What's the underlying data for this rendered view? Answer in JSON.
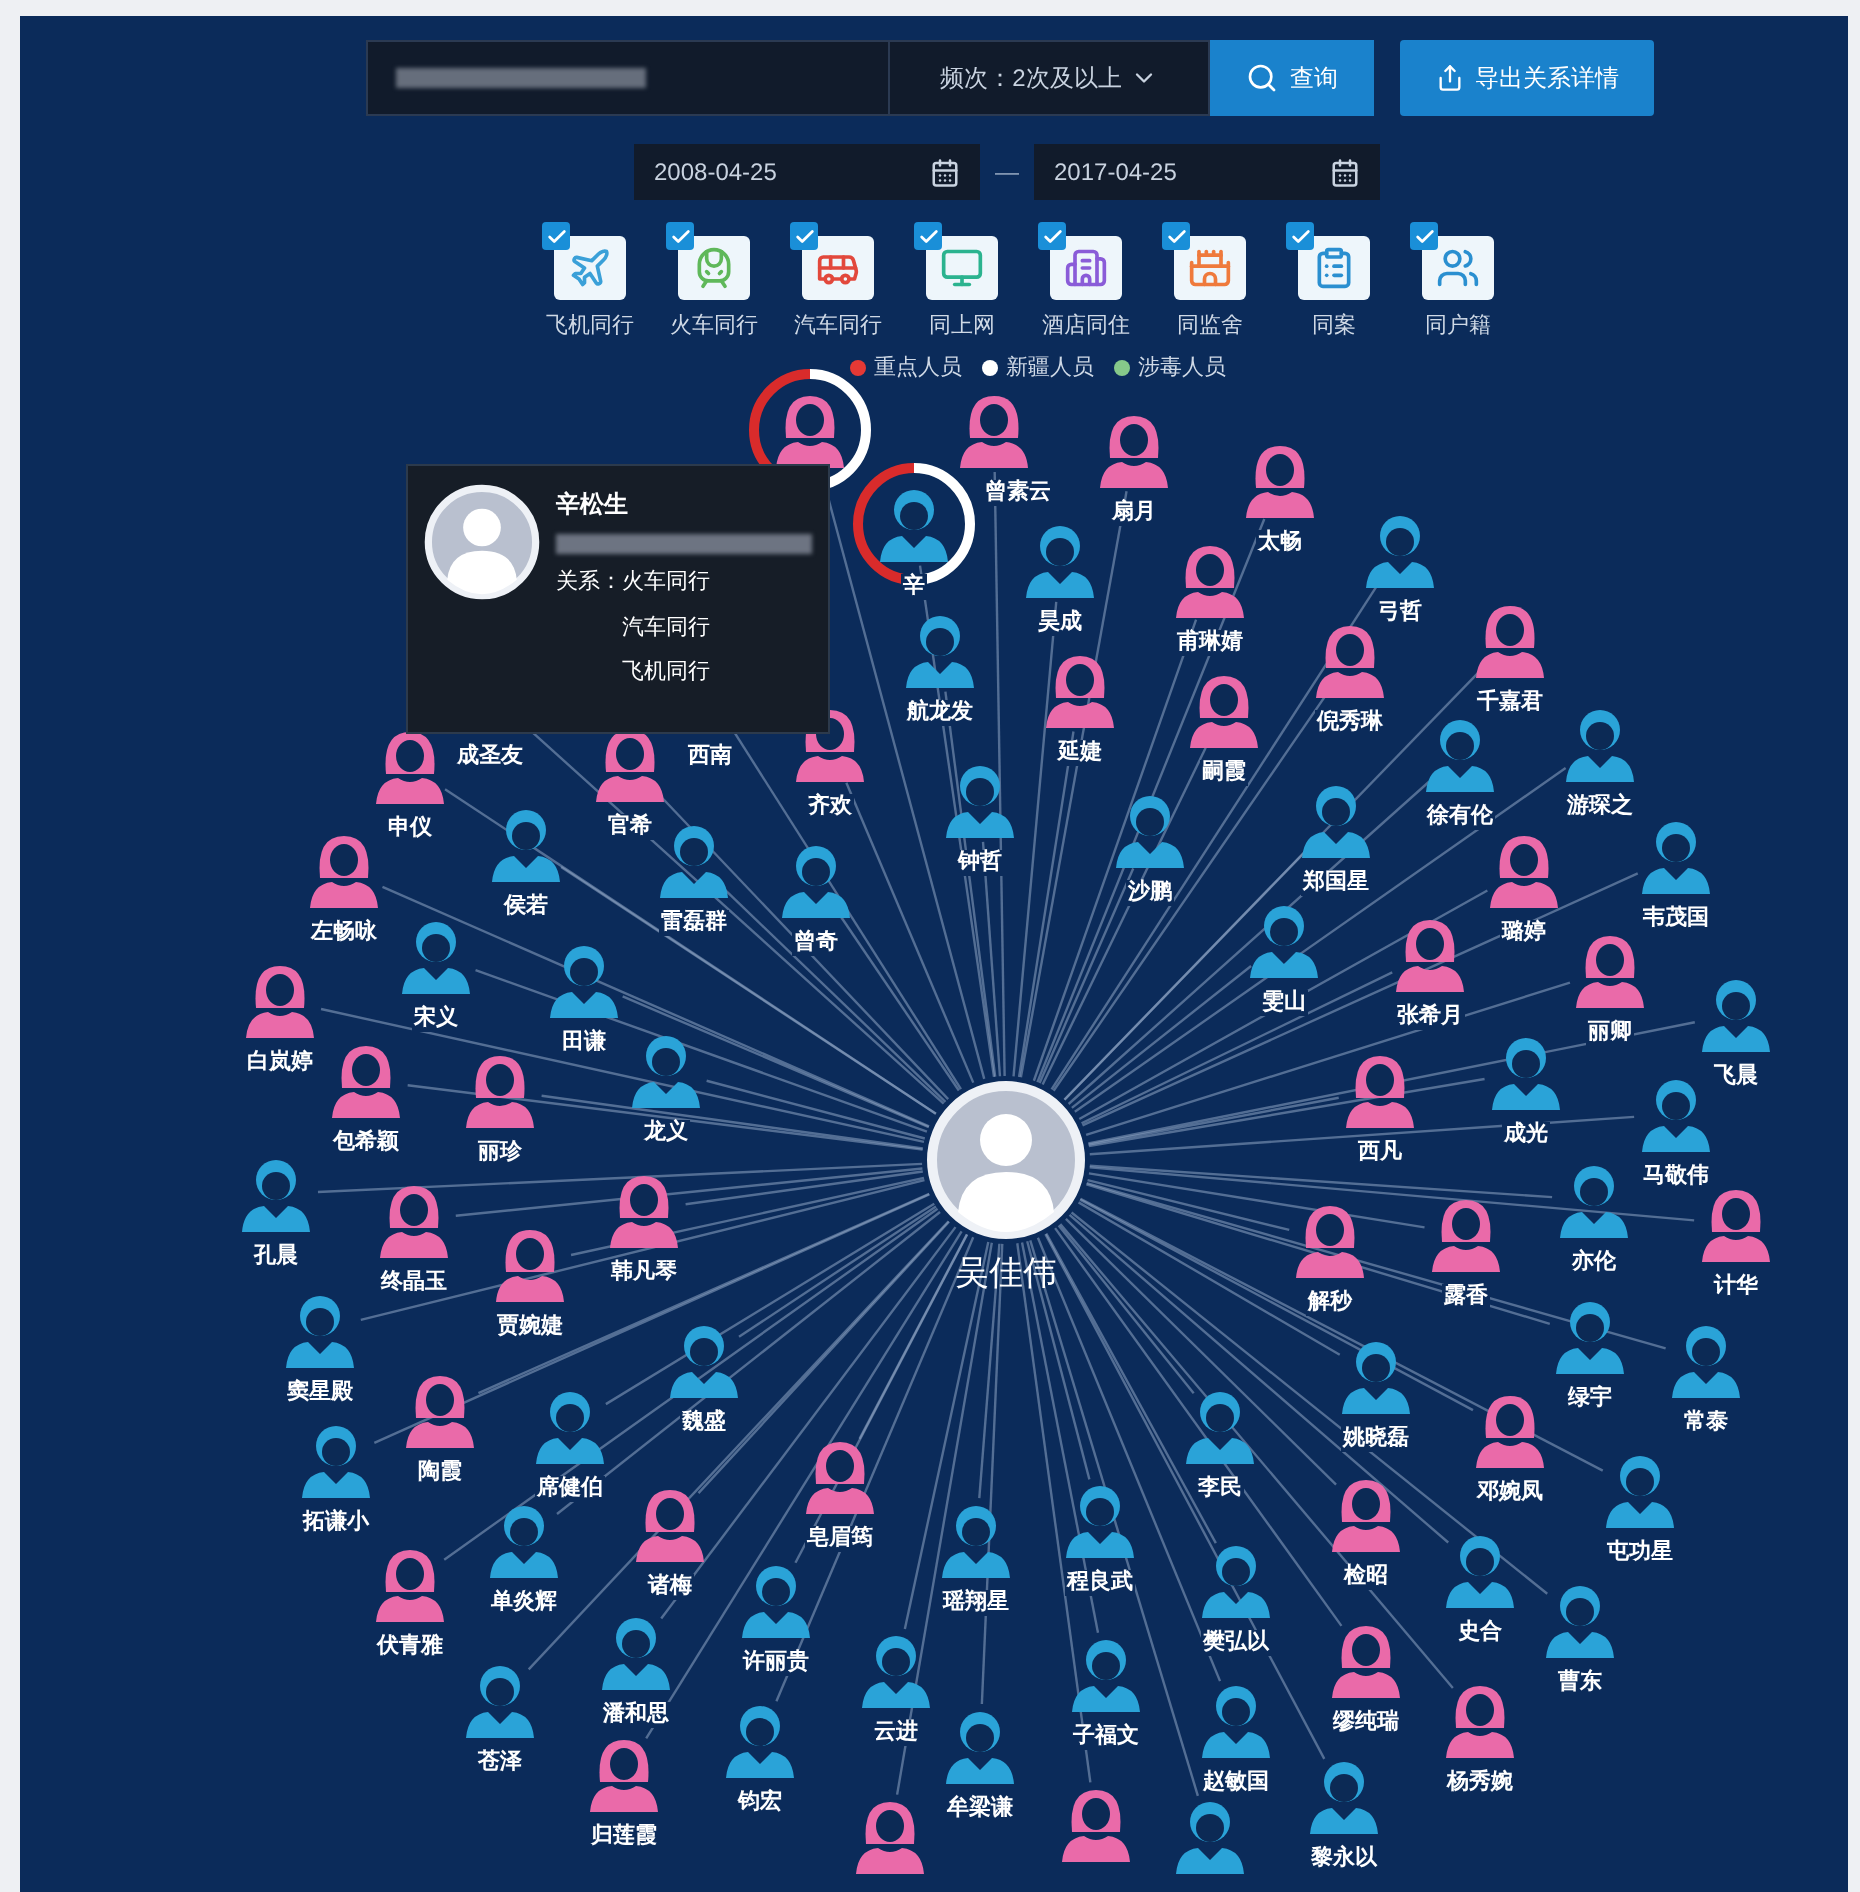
{
  "toolbar": {
    "frequency": "频次：2次及以上",
    "search_button": "查询",
    "export_button": "导出关系详情"
  },
  "date_range": {
    "start": "2008-04-25",
    "separator": "—",
    "end": "2017-04-25"
  },
  "filters": [
    {
      "kind": "plane",
      "label": "飞机同行",
      "checked": true
    },
    {
      "kind": "train",
      "label": "火车同行",
      "checked": true
    },
    {
      "kind": "bus",
      "label": "汽车同行",
      "checked": true
    },
    {
      "kind": "computer",
      "label": "同上网",
      "checked": true
    },
    {
      "kind": "hotel",
      "label": "酒店同住",
      "checked": true
    },
    {
      "kind": "prison",
      "label": "同监舍",
      "checked": true
    },
    {
      "kind": "case",
      "label": "同案",
      "checked": true
    },
    {
      "kind": "household",
      "label": "同户籍",
      "checked": true
    }
  ],
  "legend": [
    {
      "label": "重点人员",
      "color": "#e53935"
    },
    {
      "label": "新疆人员",
      "color": "#ffffff"
    },
    {
      "label": "涉毒人员",
      "color": "#86c98a"
    }
  ],
  "center": {
    "name": "吴佳伟"
  },
  "nodes": [
    {
      "kind": "female",
      "key_person": true,
      "xinjiang": true
    },
    {
      "name": "曾素云",
      "kind": "female",
      "key_person": false,
      "xinjiang": false
    },
    {
      "name": "辛",
      "kind": "male",
      "key_person": true,
      "xinjiang": true
    },
    {
      "name": "扇月",
      "kind": "female",
      "key_person": false,
      "xinjiang": false
    },
    {
      "name": "太畅",
      "kind": "female",
      "key_person": false,
      "xinjiang": false
    },
    {
      "name": "昊成",
      "kind": "male",
      "key_person": false,
      "xinjiang": false
    },
    {
      "name": "甫琳婧",
      "kind": "female",
      "key_person": false,
      "xinjiang": false
    },
    {
      "name": "弓哲",
      "kind": "male",
      "key_person": false,
      "xinjiang": false
    },
    {
      "name": "千嘉君",
      "kind": "female",
      "key_person": false,
      "xinjiang": false
    },
    {
      "name": "倪秀琳",
      "kind": "female",
      "key_person": false,
      "xinjiang": false
    },
    {
      "name": "航龙发",
      "kind": "male",
      "key_person": false,
      "xinjiang": false
    },
    {
      "name": "延婕",
      "kind": "female",
      "key_person": false,
      "xinjiang": false
    },
    {
      "name": "嗣霞",
      "kind": "female",
      "key_person": false,
      "xinjiang": false
    },
    {
      "name": "徐有伦",
      "kind": "male",
      "key_person": false,
      "xinjiang": false
    },
    {
      "name": "游琛之",
      "kind": "male",
      "key_person": false,
      "xinjiang": false
    },
    {
      "name": "钟哲",
      "kind": "male",
      "key_person": false,
      "xinjiang": false
    },
    {
      "name": "沙鹏",
      "kind": "male",
      "key_person": false,
      "xinjiang": false
    },
    {
      "name": "郑国星",
      "kind": "male",
      "key_person": false,
      "xinjiang": false
    },
    {
      "name": "璐婷",
      "kind": "female",
      "key_person": false,
      "xinjiang": false
    },
    {
      "name": "韦茂国",
      "kind": "male",
      "key_person": false,
      "xinjiang": false
    },
    {
      "name": "雯山",
      "kind": "male",
      "key_person": false,
      "xinjiang": false
    },
    {
      "name": "张希月",
      "kind": "female",
      "key_person": false,
      "xinjiang": false
    },
    {
      "name": "丽卿",
      "kind": "female",
      "key_person": false,
      "xinjiang": false
    },
    {
      "name": "飞晨",
      "kind": "male",
      "key_person": false,
      "xinjiang": false
    },
    {
      "name": "西凡",
      "kind": "female",
      "key_person": false,
      "xinjiang": false
    },
    {
      "name": "成光",
      "kind": "male",
      "key_person": false,
      "xinjiang": false
    },
    {
      "name": "马敬伟",
      "kind": "male",
      "key_person": false,
      "xinjiang": false
    },
    {
      "name": "解秒",
      "kind": "female",
      "key_person": false,
      "xinjiang": false
    },
    {
      "name": "露香",
      "kind": "female",
      "key_person": false,
      "xinjiang": false
    },
    {
      "name": "亦伦",
      "kind": "male",
      "key_person": false,
      "xinjiang": false
    },
    {
      "name": "计华",
      "kind": "female",
      "key_person": false,
      "xinjiang": false
    },
    {
      "name": "绿宇",
      "kind": "male",
      "key_person": false,
      "xinjiang": false
    },
    {
      "name": "常泰",
      "kind": "male",
      "key_person": false,
      "xinjiang": false
    },
    {
      "name": "姚晓磊",
      "kind": "male",
      "key_person": false,
      "xinjiang": false
    },
    {
      "name": "李民",
      "kind": "male",
      "key_person": false,
      "xinjiang": false
    },
    {
      "name": "邓婉凤",
      "kind": "female",
      "key_person": false,
      "xinjiang": false
    },
    {
      "name": "检昭",
      "kind": "female",
      "key_person": false,
      "xinjiang": false
    },
    {
      "name": "屯功星",
      "kind": "male",
      "key_person": false,
      "xinjiang": false
    },
    {
      "name": "史合",
      "kind": "male",
      "key_person": false,
      "xinjiang": false
    },
    {
      "name": "曹东",
      "kind": "male",
      "key_person": false,
      "xinjiang": false
    },
    {
      "name": "樊弘以",
      "kind": "male",
      "key_person": false,
      "xinjiang": false
    },
    {
      "name": "缪纯瑞",
      "kind": "female",
      "key_person": false,
      "xinjiang": false
    },
    {
      "name": "杨秀婉",
      "kind": "female",
      "key_person": false,
      "xinjiang": false
    },
    {
      "name": "程良武",
      "kind": "male",
      "key_person": false,
      "xinjiang": false
    },
    {
      "name": "子福文",
      "kind": "male",
      "key_person": false,
      "xinjiang": false
    },
    {
      "name": "赵敏国",
      "kind": "male",
      "key_person": false,
      "xinjiang": false
    },
    {
      "name": "黎永以",
      "kind": "male",
      "key_person": false,
      "xinjiang": false
    },
    {
      "name": "瑶翔星",
      "kind": "male",
      "key_person": false,
      "xinjiang": false
    },
    {
      "name": "皂眉筠",
      "kind": "female",
      "key_person": false,
      "xinjiang": false
    },
    {
      "name": "牟梁谦",
      "kind": "male",
      "key_person": false,
      "xinjiang": false
    },
    {
      "name": "云进",
      "kind": "male",
      "key_person": false,
      "xinjiang": false
    },
    {
      "name": "钧宏",
      "kind": "male",
      "key_person": false,
      "xinjiang": false
    },
    {
      "name": "许丽贵",
      "kind": "male",
      "key_person": false,
      "xinjiang": false
    },
    {
      "name": "诸梅",
      "kind": "female",
      "key_person": false,
      "xinjiang": false
    },
    {
      "name": "潘和思",
      "kind": "male",
      "key_person": false,
      "xinjiang": false
    },
    {
      "name": "归莲霞",
      "kind": "female",
      "key_person": false,
      "xinjiang": false
    },
    {
      "name": "苍泽",
      "kind": "male",
      "key_person": false,
      "xinjiang": false
    },
    {
      "name": "伏青雅",
      "kind": "female",
      "key_person": false,
      "xinjiang": false
    },
    {
      "name": "单炎辉",
      "kind": "male",
      "key_person": false,
      "xinjiang": false
    },
    {
      "name": "拓谦小",
      "kind": "male",
      "key_person": false,
      "xinjiang": false
    },
    {
      "name": "陶霞",
      "kind": "female",
      "key_person": false,
      "xinjiang": false
    },
    {
      "name": "席健伯",
      "kind": "male",
      "key_person": false,
      "xinjiang": false
    },
    {
      "name": "魏盛",
      "kind": "male",
      "key_person": false,
      "xinjiang": false
    },
    {
      "name": "窦星殿",
      "kind": "male",
      "key_person": false,
      "xinjiang": false
    },
    {
      "name": "贾婉婕",
      "kind": "female",
      "key_person": false,
      "xinjiang": false
    },
    {
      "name": "终晶玉",
      "kind": "female",
      "key_person": false,
      "xinjiang": false
    },
    {
      "name": "韩凡琴",
      "kind": "female",
      "key_person": false,
      "xinjiang": false
    },
    {
      "name": "孔晨",
      "kind": "male",
      "key_person": false,
      "xinjiang": false
    },
    {
      "name": "包希颖",
      "kind": "female",
      "key_person": false,
      "xinjiang": false
    },
    {
      "name": "丽珍",
      "kind": "female",
      "key_person": false,
      "xinjiang": false
    },
    {
      "name": "龙义",
      "kind": "male",
      "key_person": false,
      "xinjiang": false
    },
    {
      "name": "白岚婷",
      "kind": "female",
      "key_person": false,
      "xinjiang": false
    },
    {
      "name": "宋义",
      "kind": "male",
      "key_person": false,
      "xinjiang": false
    },
    {
      "name": "田谦",
      "kind": "male",
      "key_person": false,
      "xinjiang": false
    },
    {
      "name": "左畅咏",
      "kind": "female",
      "key_person": false,
      "xinjiang": false
    },
    {
      "name": "侯若",
      "kind": "male",
      "key_person": false,
      "xinjiang": false
    },
    {
      "name": "雷磊群",
      "kind": "male",
      "key_person": false,
      "xinjiang": false
    },
    {
      "name": "曾奇",
      "kind": "male",
      "key_person": false,
      "xinjiang": false
    },
    {
      "name": "申仪",
      "kind": "female",
      "key_person": false,
      "xinjiang": false
    },
    {
      "name": "成圣友"
    },
    {
      "name": "西南"
    },
    {
      "name": "官希",
      "kind": "female",
      "key_person": false,
      "xinjiang": false
    },
    {
      "name": "齐欢",
      "kind": "female",
      "key_person": false,
      "xinjiang": false
    },
    {
      "kind": "female",
      "key_person": false,
      "xinjiang": false
    },
    {
      "kind": "female",
      "key_person": false,
      "xinjiang": false
    },
    {
      "kind": "male",
      "key_person": false,
      "xinjiang": false
    }
  ],
  "tooltip": {
    "name": "辛松生",
    "relation_label": "关系：",
    "relations": [
      "火车同行",
      "汽车同行",
      "飞机同行"
    ]
  }
}
